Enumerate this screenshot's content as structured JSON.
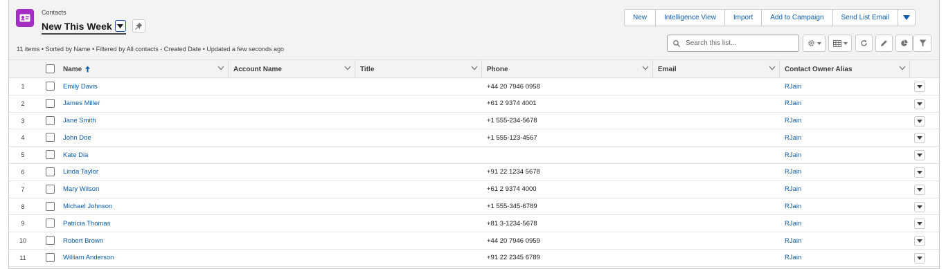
{
  "header": {
    "object_label": "Contacts",
    "list_title": "New This Week",
    "summary": "11 items • Sorted by Name • Filtered by All contacts - Created Date • Updated a few seconds ago"
  },
  "actions": {
    "new": "New",
    "intelligence_view": "Intelligence View",
    "import": "Import",
    "add_to_campaign": "Add to Campaign",
    "send_list_email": "Send List Email"
  },
  "search": {
    "placeholder": "Search this list..."
  },
  "table": {
    "columns": {
      "name": "Name",
      "account_name": "Account Name",
      "title": "Title",
      "phone": "Phone",
      "email": "Email",
      "owner_alias": "Contact Owner Alias"
    },
    "rows": [
      {
        "num": "1",
        "name": "Emily Davis",
        "account": "",
        "title": "",
        "phone": "+44 20 7946 0958",
        "email": "",
        "owner": "RJain"
      },
      {
        "num": "2",
        "name": "James Miller",
        "account": "",
        "title": "",
        "phone": "+61 2 9374 4001",
        "email": "",
        "owner": "RJain"
      },
      {
        "num": "3",
        "name": "Jane Smith",
        "account": "",
        "title": "",
        "phone": "+1 555-234-5678",
        "email": "",
        "owner": "RJain"
      },
      {
        "num": "4",
        "name": "John Doe",
        "account": "",
        "title": "",
        "phone": "+1 555-123-4567",
        "email": "",
        "owner": "RJain"
      },
      {
        "num": "5",
        "name": "Kate Dia",
        "account": "",
        "title": "",
        "phone": "",
        "email": "",
        "owner": "RJain"
      },
      {
        "num": "6",
        "name": "Linda Taylor",
        "account": "",
        "title": "",
        "phone": "+91 22 1234 5678",
        "email": "",
        "owner": "RJain"
      },
      {
        "num": "7",
        "name": "Mary Wilson",
        "account": "",
        "title": "",
        "phone": "+61 2 9374 4000",
        "email": "",
        "owner": "RJain"
      },
      {
        "num": "8",
        "name": "Michael Johnson",
        "account": "",
        "title": "",
        "phone": "+1 555-345-6789",
        "email": "",
        "owner": "RJain"
      },
      {
        "num": "9",
        "name": "Patricia Thomas",
        "account": "",
        "title": "",
        "phone": "+81 3-1234-5678",
        "email": "",
        "owner": "RJain"
      },
      {
        "num": "10",
        "name": "Robert Brown",
        "account": "",
        "title": "",
        "phone": "+44 20 7946 0959",
        "email": "",
        "owner": "RJain"
      },
      {
        "num": "11",
        "name": "William Anderson",
        "account": "",
        "title": "",
        "phone": "+91 22 2345 6789",
        "email": "",
        "owner": "RJain"
      }
    ]
  },
  "icons": {
    "object": "contact-card-icon",
    "sort": "arrow-up-icon",
    "settings": "gear-icon",
    "display": "table-icon",
    "refresh": "refresh-icon",
    "edit": "pencil-icon",
    "charts": "pie-chart-icon",
    "filter": "funnel-icon"
  },
  "colors": {
    "accent": "#0b5cab",
    "object_icon": "#a62cc6"
  }
}
